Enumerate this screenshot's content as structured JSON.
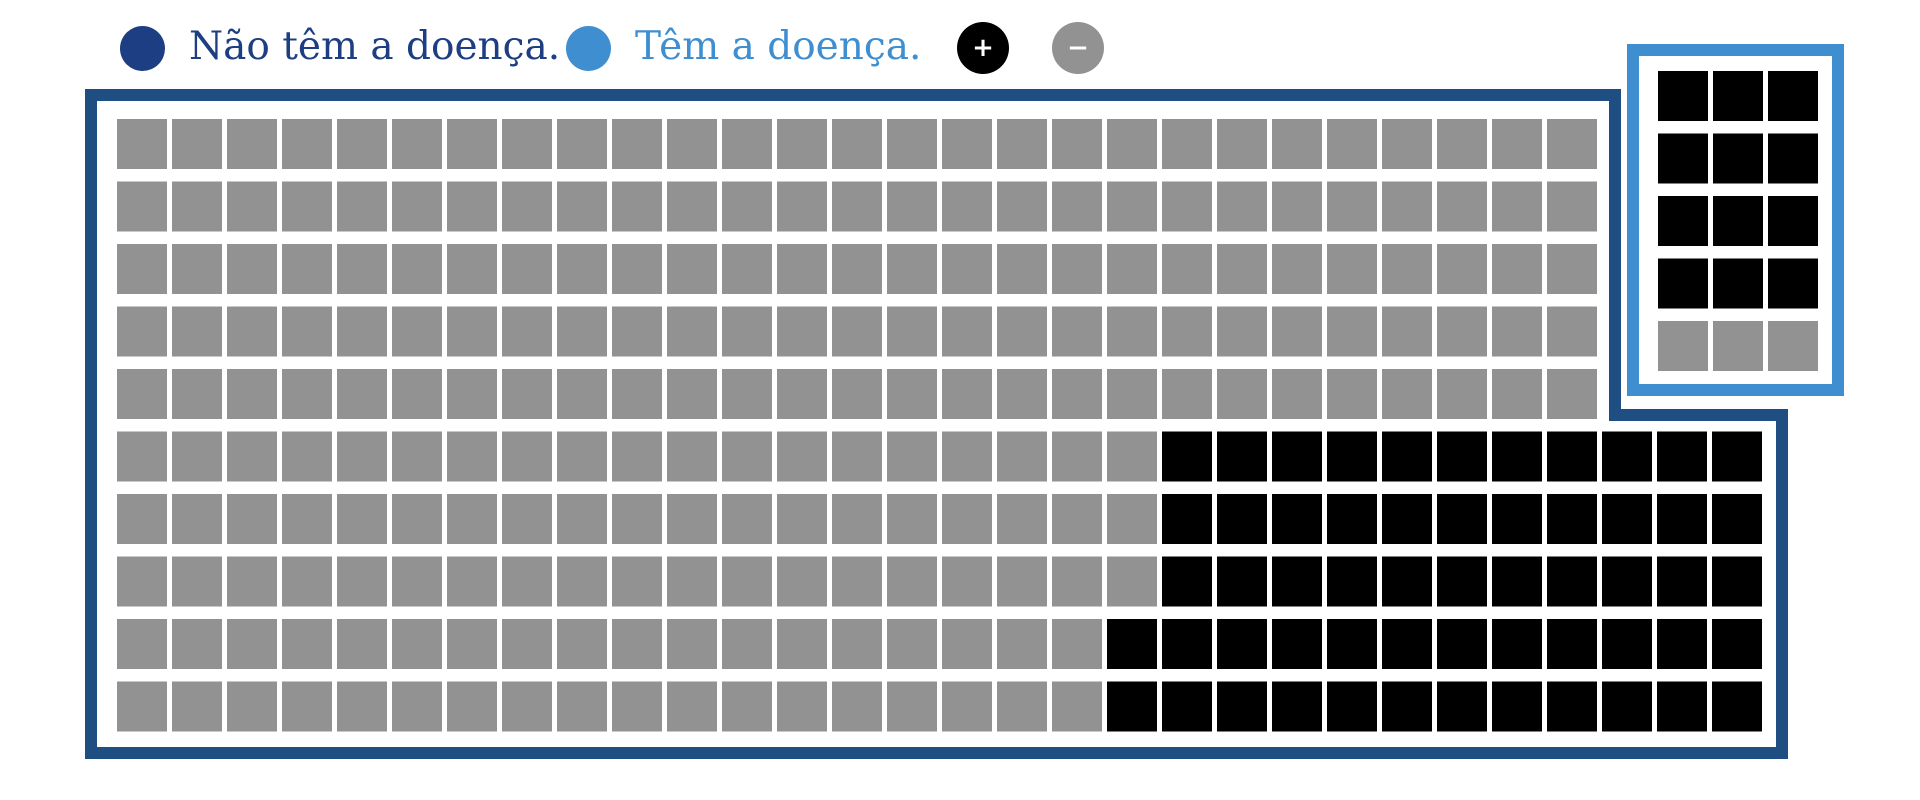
{
  "legend": {
    "healthy_label": "Não têm a doença.",
    "sick_label": "Têm a doença.",
    "plus_symbol": "+",
    "minus_symbol": "−"
  },
  "colors": {
    "healthy": "#1d3e82",
    "sick": "#3e8ed0",
    "healthy_frame": "#1f4e82",
    "sick_frame": "#3e8ed0",
    "positive_cell": "#000000",
    "negative_cell": "#929292",
    "plus_button": "#000000",
    "minus_button": "#929292"
  },
  "groups": {
    "healthy": {
      "name": "Não têm a doença.",
      "total": 290,
      "test_positive": 53,
      "test_negative": 237,
      "positive_per_row": [
        0,
        0,
        0,
        0,
        0,
        11,
        11,
        11,
        12,
        12
      ]
    },
    "sick": {
      "name": "Têm a doença.",
      "total": 15,
      "test_positive": 12,
      "test_negative": 3,
      "positive_per_row": [
        3,
        3,
        3,
        3,
        0
      ]
    }
  }
}
